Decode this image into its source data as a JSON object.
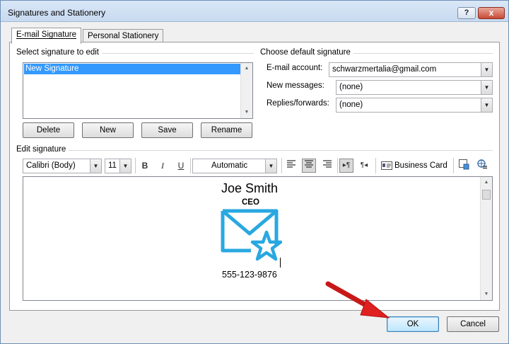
{
  "window": {
    "title": "Signatures and Stationery",
    "help_label": "?",
    "close_label": "x"
  },
  "tabs": [
    {
      "label": "E-mail Signature",
      "active": true
    },
    {
      "label": "Personal Stationery",
      "active": false
    }
  ],
  "select_signature": {
    "label": "Select signature to edit",
    "items": [
      "New Signature"
    ],
    "selected": "New Signature"
  },
  "signature_buttons": {
    "delete": "Delete",
    "new": "New",
    "save": "Save",
    "rename": "Rename"
  },
  "default_signature": {
    "label": "Choose default signature",
    "email_account_label": "E-mail account:",
    "email_account_value": "schwarzmertalia@gmail.com",
    "new_messages_label": "New messages:",
    "new_messages_value": "(none)",
    "replies_label": "Replies/forwards:",
    "replies_value": "(none)"
  },
  "edit_signature": {
    "label": "Edit signature",
    "toolbar": {
      "font": "Calibri (Body)",
      "size": "11",
      "bold": "B",
      "italic": "I",
      "underline": "U",
      "color": "Automatic",
      "business_card": "Business Card",
      "ltr_glyph": "▸¶",
      "rtl_glyph": "¶◂"
    },
    "content": {
      "name": "Joe Smith",
      "title": "CEO",
      "phone": "555-123-9876"
    }
  },
  "footer": {
    "ok": "OK",
    "cancel": "Cancel"
  },
  "colors": {
    "selection": "#3399ff",
    "logo": "#29a8e0",
    "arrow": "#e02020"
  }
}
